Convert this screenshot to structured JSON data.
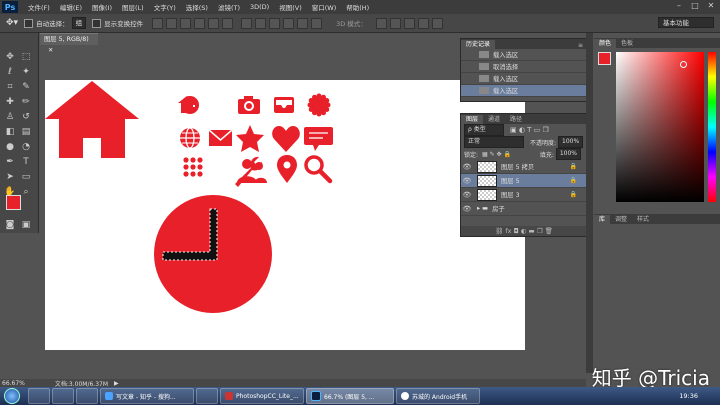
{
  "menubar": {
    "logo": "Ps",
    "items": [
      "文件(F)",
      "编辑(E)",
      "图像(I)",
      "图层(L)",
      "文字(Y)",
      "选择(S)",
      "滤镜(T)",
      "3D(D)",
      "视图(V)",
      "窗口(W)",
      "帮助(H)"
    ]
  },
  "options": {
    "auto_select_label": "自动选择：",
    "auto_select_value": "组",
    "show_transform_label": "显示变换控件",
    "mode_3d_label": "3D 模式：",
    "workspace": "基本功能"
  },
  "document": {
    "tab_title": "图层 5, RGB/8)",
    "zoom": "66.67%",
    "doc_size": "文档:3.00M/6.37M"
  },
  "history_panel": {
    "tabs": [
      "历史记录"
    ],
    "items": [
      "载入选区",
      "取消选择",
      "载入选区",
      "载入选区"
    ],
    "selected_index": 3
  },
  "layers_panel": {
    "tabs": [
      "图层",
      "通道",
      "路径"
    ],
    "kind_filter": "ρ 类型",
    "blend_mode": "正常",
    "opacity_label": "不透明度:",
    "opacity_value": "100%",
    "lock_label": "锁定:",
    "fill_label": "填充:",
    "fill_value": "100%",
    "layers": [
      {
        "name": "图层 5 拷贝",
        "selected": false
      },
      {
        "name": "图层 5",
        "selected": true
      },
      {
        "name": "图层 3",
        "selected": false
      },
      {
        "name": "房子",
        "selected": false,
        "group": true
      }
    ]
  },
  "color_panel": {
    "tabs": [
      "颜色",
      "色板"
    ],
    "foreground": "#e8202a",
    "background": "#111111"
  },
  "adjust_panel": {
    "tabs": [
      "库",
      "调整",
      "样式"
    ]
  },
  "taskbar": {
    "tasks": [
      "写文章 - 知乎 - 搜狗...",
      "PhotoshopCC_Lite_...",
      "66.7% (图层 5, ...",
      "苏城的 Android手机"
    ],
    "clock": "19:36"
  },
  "watermark": "知乎 @Tricia",
  "colors": {
    "accent_red": "#e8202a",
    "selection_blue": "#6a7d9c"
  },
  "icons": [
    "home-icon",
    "clock-icon",
    "camera-icon",
    "inbox-icon",
    "badge-icon",
    "globe-icon",
    "mail-icon",
    "star-icon",
    "heart-icon",
    "chat-icon",
    "apps-icon",
    "wrench-icon",
    "people-icon",
    "location-icon",
    "search-icon"
  ]
}
